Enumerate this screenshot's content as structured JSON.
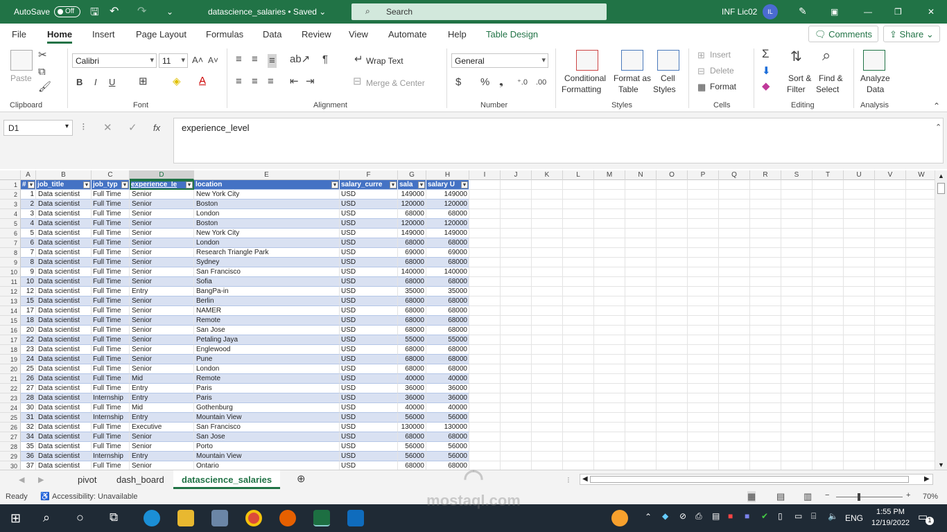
{
  "titlebar": {
    "autosave": "AutoSave",
    "toggle": "Off",
    "doc": "datascience_salaries • Saved ⌄",
    "search": "Search",
    "user": "INF Lic02",
    "initials": "IL"
  },
  "menu": [
    "File",
    "Home",
    "Insert",
    "Page Layout",
    "Formulas",
    "Data",
    "Review",
    "View",
    "Automate",
    "Help",
    "Table Design"
  ],
  "menu_buttons": {
    "comments": "Comments",
    "share": "Share"
  },
  "ribbon": {
    "clipboard": {
      "label": "Clipboard",
      "paste": "Paste"
    },
    "font": {
      "label": "Font",
      "family": "Calibri",
      "size": "11"
    },
    "alignment": {
      "label": "Alignment",
      "wrap": "Wrap Text",
      "merge": "Merge & Center"
    },
    "number": {
      "label": "Number",
      "format": "General"
    },
    "styles": {
      "label": "Styles",
      "conditional": "Conditional",
      "formatting": "Formatting",
      "format_as": "Format as",
      "table": "Table",
      "cell": "Cell",
      "cell_styles": "Styles"
    },
    "cells": {
      "label": "Cells",
      "insert": "Insert",
      "delete": "Delete",
      "format": "Format"
    },
    "editing": {
      "label": "Editing",
      "sort": "Sort &",
      "filter": "Filter",
      "find": "Find &",
      "select": "Select"
    },
    "analysis": {
      "label": "Analysis",
      "analyze": "Analyze",
      "data": "Data"
    }
  },
  "formula": {
    "namebox": "D1",
    "fx": "fx",
    "content": "experience_level"
  },
  "columns": [
    "A",
    "B",
    "C",
    "D",
    "E",
    "F",
    "G",
    "H",
    "I",
    "J",
    "K",
    "L",
    "M",
    "N",
    "O",
    "P",
    "Q",
    "R",
    "S",
    "T",
    "U",
    "V",
    "W"
  ],
  "headers": [
    "#",
    "job_title",
    "job_typ",
    "experience_le",
    "location",
    "salary_curre",
    "sala",
    "salary U"
  ],
  "rows": [
    [
      "1",
      "Data scientist",
      "Full Time",
      "Senior",
      "New York City",
      "USD",
      "149000",
      "149000"
    ],
    [
      "2",
      "Data scientist",
      "Full Time",
      "Senior",
      "Boston",
      "USD",
      "120000",
      "120000"
    ],
    [
      "3",
      "Data scientist",
      "Full Time",
      "Senior",
      "London",
      "USD",
      "68000",
      "68000"
    ],
    [
      "4",
      "Data scientist",
      "Full Time",
      "Senior",
      "Boston",
      "USD",
      "120000",
      "120000"
    ],
    [
      "5",
      "Data scientist",
      "Full Time",
      "Senior",
      "New York City",
      "USD",
      "149000",
      "149000"
    ],
    [
      "6",
      "Data scientist",
      "Full Time",
      "Senior",
      "London",
      "USD",
      "68000",
      "68000"
    ],
    [
      "7",
      "Data scientist",
      "Full Time",
      "Senior",
      "Research Triangle Park",
      "USD",
      "69000",
      "69000"
    ],
    [
      "8",
      "Data scientist",
      "Full Time",
      "Senior",
      "Sydney",
      "USD",
      "68000",
      "68000"
    ],
    [
      "9",
      "Data scientist",
      "Full Time",
      "Senior",
      "San Francisco",
      "USD",
      "140000",
      "140000"
    ],
    [
      "10",
      "Data scientist",
      "Full Time",
      "Senior",
      "Sofia",
      "USD",
      "68000",
      "68000"
    ],
    [
      "12",
      "Data scientist",
      "Full Time",
      "Entry",
      "BangPa-in",
      "USD",
      "35000",
      "35000"
    ],
    [
      "15",
      "Data scientist",
      "Full Time",
      "Senior",
      "Berlin",
      "USD",
      "68000",
      "68000"
    ],
    [
      "17",
      "Data scientist",
      "Full Time",
      "Senior",
      "NAMER",
      "USD",
      "68000",
      "68000"
    ],
    [
      "18",
      "Data scientist",
      "Full Time",
      "Senior",
      "Remote",
      "USD",
      "68000",
      "68000"
    ],
    [
      "20",
      "Data scientist",
      "Full Time",
      "Senior",
      "San Jose",
      "USD",
      "68000",
      "68000"
    ],
    [
      "22",
      "Data scientist",
      "Full Time",
      "Senior",
      "Petaling Jaya",
      "USD",
      "55000",
      "55000"
    ],
    [
      "23",
      "Data scientist",
      "Full Time",
      "Senior",
      "Englewood",
      "USD",
      "68000",
      "68000"
    ],
    [
      "24",
      "Data scientist",
      "Full Time",
      "Senior",
      "Pune",
      "USD",
      "68000",
      "68000"
    ],
    [
      "25",
      "Data scientist",
      "Full Time",
      "Senior",
      "London",
      "USD",
      "68000",
      "68000"
    ],
    [
      "26",
      "Data scientist",
      "Full Time",
      "Mid",
      "Remote",
      "USD",
      "40000",
      "40000"
    ],
    [
      "27",
      "Data scientist",
      "Full Time",
      "Entry",
      "Paris",
      "USD",
      "36000",
      "36000"
    ],
    [
      "28",
      "Data scientist",
      "Internship",
      "Entry",
      "Paris",
      "USD",
      "36000",
      "36000"
    ],
    [
      "30",
      "Data scientist",
      "Full Time",
      "Mid",
      "Gothenburg",
      "USD",
      "40000",
      "40000"
    ],
    [
      "31",
      "Data scientist",
      "Internship",
      "Entry",
      "Mountain View",
      "USD",
      "56000",
      "56000"
    ],
    [
      "32",
      "Data scientist",
      "Full Time",
      "Executive",
      "San Francisco",
      "USD",
      "130000",
      "130000"
    ],
    [
      "34",
      "Data scientist",
      "Full Time",
      "Senior",
      "San Jose",
      "USD",
      "68000",
      "68000"
    ],
    [
      "35",
      "Data scientist",
      "Full Time",
      "Senior",
      "Porto",
      "USD",
      "56000",
      "56000"
    ],
    [
      "36",
      "Data scientist",
      "Internship",
      "Entry",
      "Mountain View",
      "USD",
      "56000",
      "56000"
    ],
    [
      "37",
      "Data scientist",
      "Full Time",
      "Senior",
      "Ontario",
      "USD",
      "68000",
      "68000"
    ]
  ],
  "sheets": [
    "pivot",
    "dash_board",
    "datascience_salaries"
  ],
  "status": {
    "ready": "Ready",
    "accessibility": "Accessibility: Unavailable",
    "zoom": "70%"
  },
  "taskbar": {
    "lang": "ENG",
    "time": "1:55 PM",
    "date": "12/19/2022",
    "notif": "1"
  },
  "watermark": {
    "text": "mostaql.com"
  }
}
